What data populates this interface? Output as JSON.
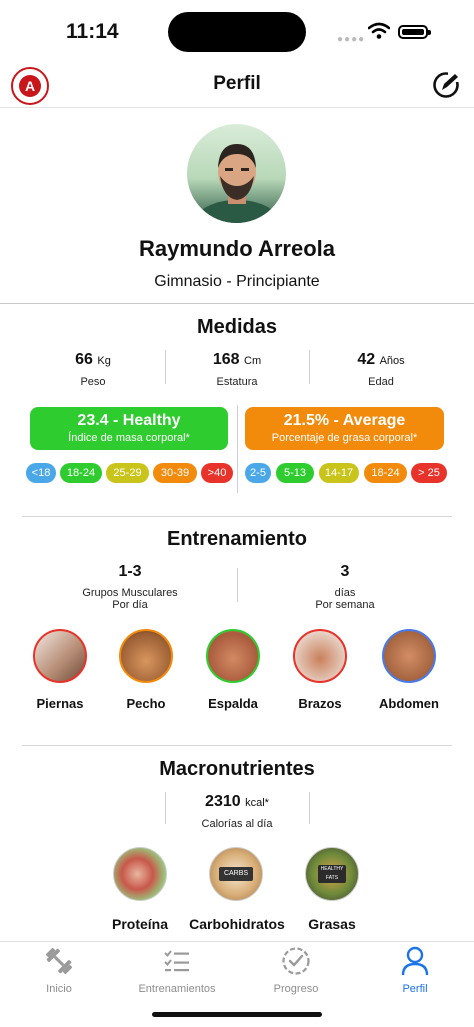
{
  "status_bar": {
    "time": "11:14"
  },
  "header": {
    "title": "Perfil",
    "logo_letter": "A",
    "edit_icon": "edit-icon"
  },
  "profile": {
    "name": "Raymundo Arreola",
    "subtitle": "Gimnasio - Principiante"
  },
  "measures": {
    "title": "Medidas",
    "stats": [
      {
        "value": "66",
        "unit": "Kg",
        "label": "Peso"
      },
      {
        "value": "168",
        "unit": "Cm",
        "label": "Estatura"
      },
      {
        "value": "42",
        "unit": "Años",
        "label": "Edad"
      }
    ],
    "bmi": {
      "value": "23.4 - Healthy",
      "label": "Índice de masa corporal*",
      "color": "#2ecc2e",
      "ranges": [
        "<18",
        "18-24",
        "25-29",
        "30-39",
        ">40"
      ]
    },
    "body_fat": {
      "value": "21.5% - Average",
      "label": "Porcentaje de grasa corporal*",
      "color": "#f28a0c",
      "ranges": [
        "2-5",
        "5-13",
        "14-17",
        "18-24",
        "> 25"
      ]
    },
    "range_colors": [
      "#4aa8e8",
      "#2ecc2e",
      "#c9c41a",
      "#f28a0c",
      "#e8332a"
    ]
  },
  "training": {
    "title": "Entrenamiento",
    "groups": {
      "value": "1-3",
      "label_line1": "Grupos Musculares",
      "label_line2": "Por día"
    },
    "days": {
      "value": "3",
      "label_line1": "días",
      "label_line2": "Por semana"
    },
    "muscles": [
      {
        "label": "Piernas",
        "border": "#e8332a"
      },
      {
        "label": "Pecho",
        "border": "#f28a0c"
      },
      {
        "label": "Espalda",
        "border": "#2ecc2e"
      },
      {
        "label": "Brazos",
        "border": "#e8332a"
      },
      {
        "label": "Abdomen",
        "border": "#4a7ae8"
      }
    ]
  },
  "macros": {
    "title": "Macronutrientes",
    "calories": {
      "value": "2310",
      "unit": "kcal*",
      "label": "Calorías al día"
    },
    "items": [
      {
        "label": "Proteína"
      },
      {
        "label": "Carbohidratos",
        "image_text": "CARBS"
      },
      {
        "label": "Grasas",
        "image_text": "HEALTHY FATS"
      }
    ]
  },
  "tabbar": {
    "items": [
      {
        "label": "Inicio",
        "icon": "dumbbell-icon"
      },
      {
        "label": "Entrenamientos",
        "icon": "checklist-icon"
      },
      {
        "label": "Progreso",
        "icon": "progress-check-icon"
      },
      {
        "label": "Perfil",
        "icon": "person-icon",
        "active": true
      }
    ],
    "active_color": "#1a73e8"
  }
}
